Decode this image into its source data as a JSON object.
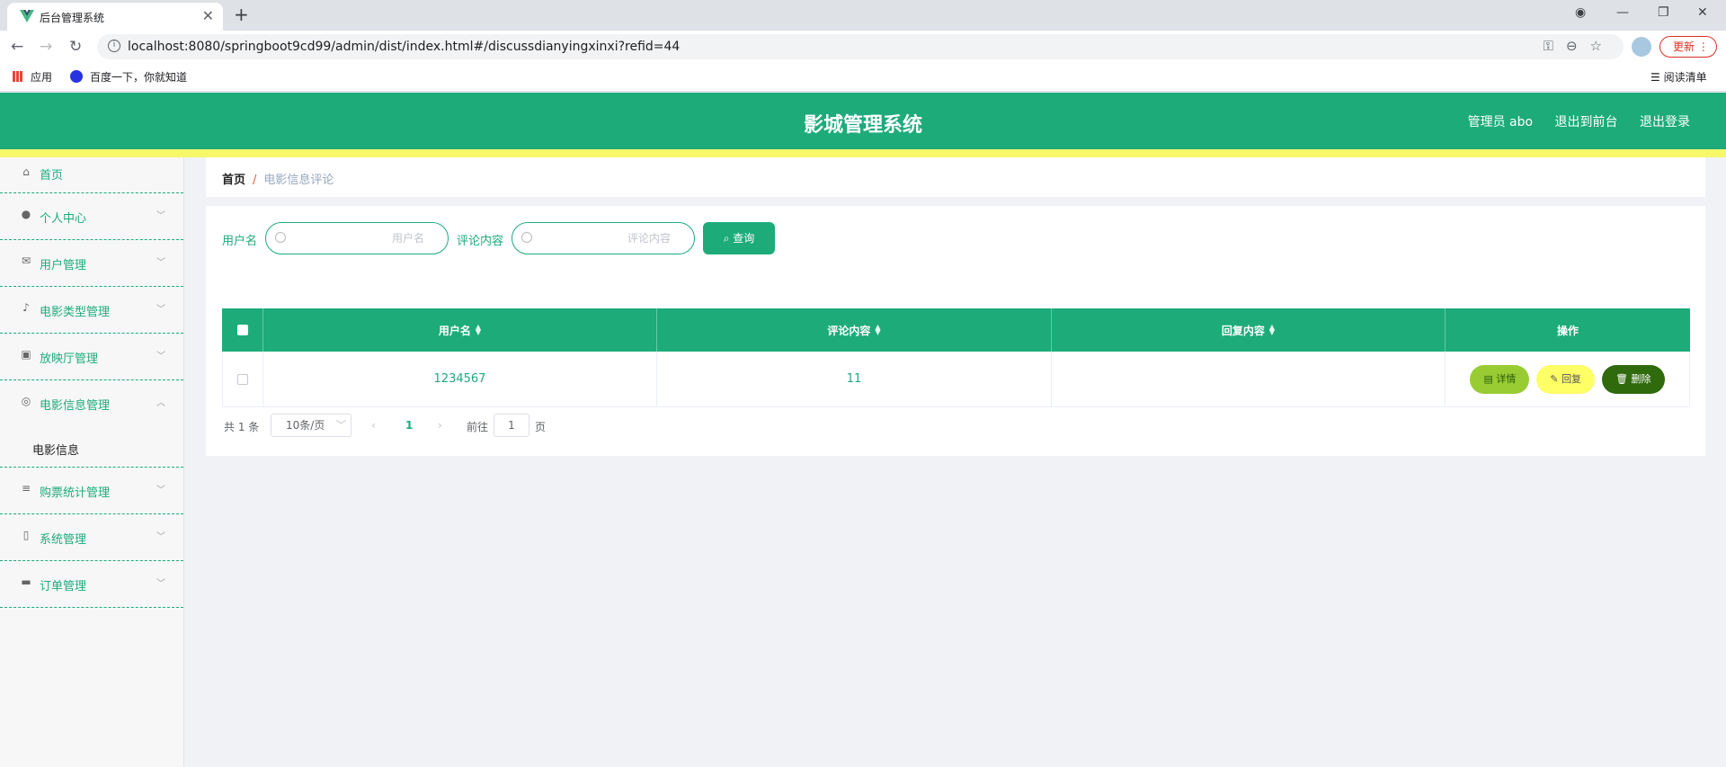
{
  "browser": {
    "tab_title": "后台管理系统",
    "url": "localhost:8080/springboot9cd99/admin/dist/index.html#/discussdianyingxinxi?refid=44",
    "update_label": "更新",
    "bookmarks": {
      "apps": "应用",
      "baidu": "百度一下，你就知道",
      "reading_list": "阅读清单"
    }
  },
  "header": {
    "title": "影城管理系统",
    "user": "管理员 abo",
    "to_front": "退出到前台",
    "logout": "退出登录"
  },
  "sidebar": {
    "items": [
      {
        "label": "首页",
        "icon": "home-icon"
      },
      {
        "label": "个人中心",
        "icon": "user-icon"
      },
      {
        "label": "用户管理",
        "icon": "mail-icon"
      },
      {
        "label": "电影类型管理",
        "icon": "mic-icon"
      },
      {
        "label": "放映厅管理",
        "icon": "clipboard-icon"
      },
      {
        "label": "电影信息管理",
        "icon": "compass-icon"
      },
      {
        "label": "购票统计管理",
        "icon": "sliders-icon"
      },
      {
        "label": "系统管理",
        "icon": "phone-icon"
      },
      {
        "label": "订单管理",
        "icon": "camera-icon"
      }
    ],
    "submenu_label": "电影信息"
  },
  "breadcrumb": {
    "home": "首页",
    "sep": "/",
    "current": "电影信息评论"
  },
  "search": {
    "username_label": "用户名",
    "username_placeholder": "用户名",
    "content_label": "评论内容",
    "content_placeholder": "评论内容",
    "query_button": "查询"
  },
  "table": {
    "headers": [
      "用户名",
      "评论内容",
      "回复内容",
      "操作"
    ],
    "rows": [
      {
        "username": "1234567",
        "content": "11",
        "reply": ""
      }
    ],
    "actions": {
      "detail": "详情",
      "reply": "回复",
      "delete": "删除"
    }
  },
  "pagination": {
    "total": "共 1 条",
    "page_size": "10条/页",
    "current_page": "1",
    "goto_label": "前往",
    "goto_value": "1",
    "page_suffix": "页"
  },
  "colors": {
    "primary": "#1dab7a",
    "strip": "#f7f76a"
  }
}
